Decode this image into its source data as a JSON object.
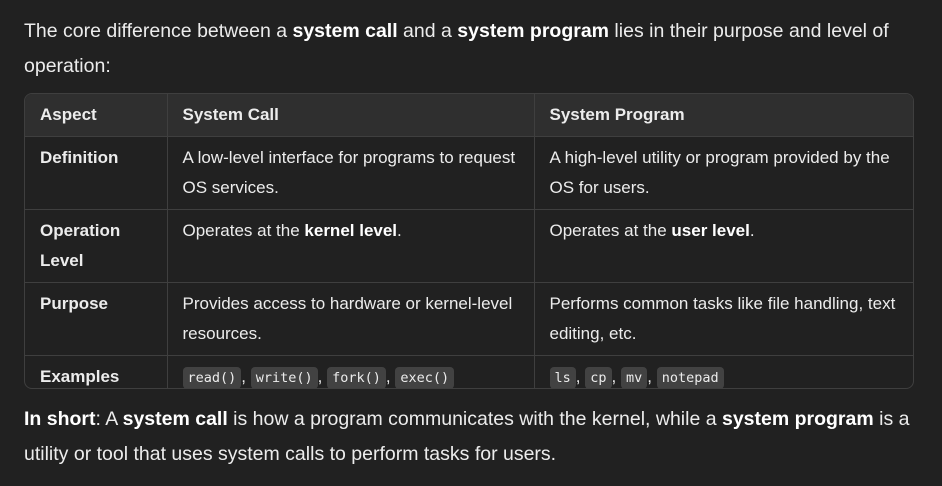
{
  "intro": {
    "t1": "The core difference between a ",
    "b1": "system call",
    "t2": " and a ",
    "b2": "system program",
    "t3": " lies in their purpose and level of operation:"
  },
  "table": {
    "headers": [
      "Aspect",
      "System Call",
      "System Program"
    ],
    "rows": [
      {
        "aspect": "Definition",
        "call": "A low-level interface for programs to request OS services.",
        "program": "A high-level utility or program provided by the OS for users."
      },
      {
        "aspect": "Operation Level",
        "call_pre": "Operates at the ",
        "call_bold": "kernel level",
        "call_post": ".",
        "program_pre": "Operates at the ",
        "program_bold": "user level",
        "program_post": "."
      },
      {
        "aspect": "Purpose",
        "call": "Provides access to hardware or kernel-level resources.",
        "program": "Performs common tasks like file handling, text editing, etc."
      },
      {
        "aspect": "Examples",
        "call_codes": [
          "read()",
          "write()",
          "fork()",
          "exec()"
        ],
        "program_codes": [
          "ls",
          "cp",
          "mv",
          "notepad"
        ],
        "separator": ","
      }
    ]
  },
  "summary": {
    "b1": "In short",
    "t1": ": A ",
    "b2": "system call",
    "t2": " is how a program communicates with the kernel, while a ",
    "b3": "system program",
    "t3": " is a utility or tool that uses system calls to perform tasks for users."
  }
}
